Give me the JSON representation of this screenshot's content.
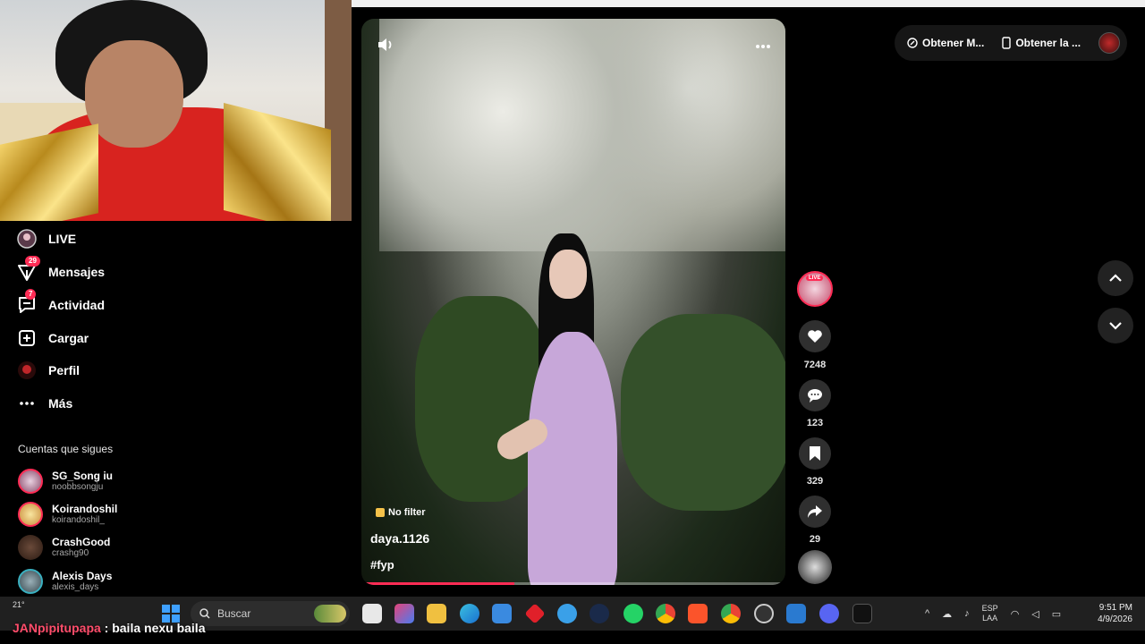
{
  "sidebar": {
    "items": [
      {
        "label": "LIVE",
        "icon": "live-icon"
      },
      {
        "label": "Mensajes",
        "icon": "paper-plane-icon",
        "badge": "29"
      },
      {
        "label": "Actividad",
        "icon": "message-icon",
        "badge": "7"
      },
      {
        "label": "Cargar",
        "icon": "plus-square-icon"
      },
      {
        "label": "Perfil",
        "icon": "profile-avatar-icon"
      },
      {
        "label": "Más",
        "icon": "more-dots-icon"
      }
    ],
    "following_title": "Cuentas que sigues",
    "following": [
      {
        "name": "SG_Song iu",
        "handle": "noobbsongju"
      },
      {
        "name": "Koirandoshil",
        "handle": "koirandoshil_"
      },
      {
        "name": "CrashGood",
        "handle": "crashg90"
      },
      {
        "name": "Alexis Days",
        "handle": "alexis_days"
      }
    ]
  },
  "video": {
    "filter_tag": "No filter",
    "author": "daya.1126",
    "hashtag": "#fyp",
    "progress": 0.36,
    "live_label": "LIVE"
  },
  "actions": {
    "likes": "7248",
    "comments": "123",
    "saves": "329",
    "shares": "29"
  },
  "topbar": {
    "btn1": "Obtener M...",
    "btn2": "Obtener la ..."
  },
  "taskbar": {
    "weather": "21°",
    "search_placeholder": "Buscar",
    "lang_top": "ESP",
    "lang_bottom": "LAA",
    "time": "9:51 PM",
    "date": "4/9/2026"
  },
  "chat": {
    "user": "JANpipitupapa",
    "message": " : baila nexu baila"
  }
}
